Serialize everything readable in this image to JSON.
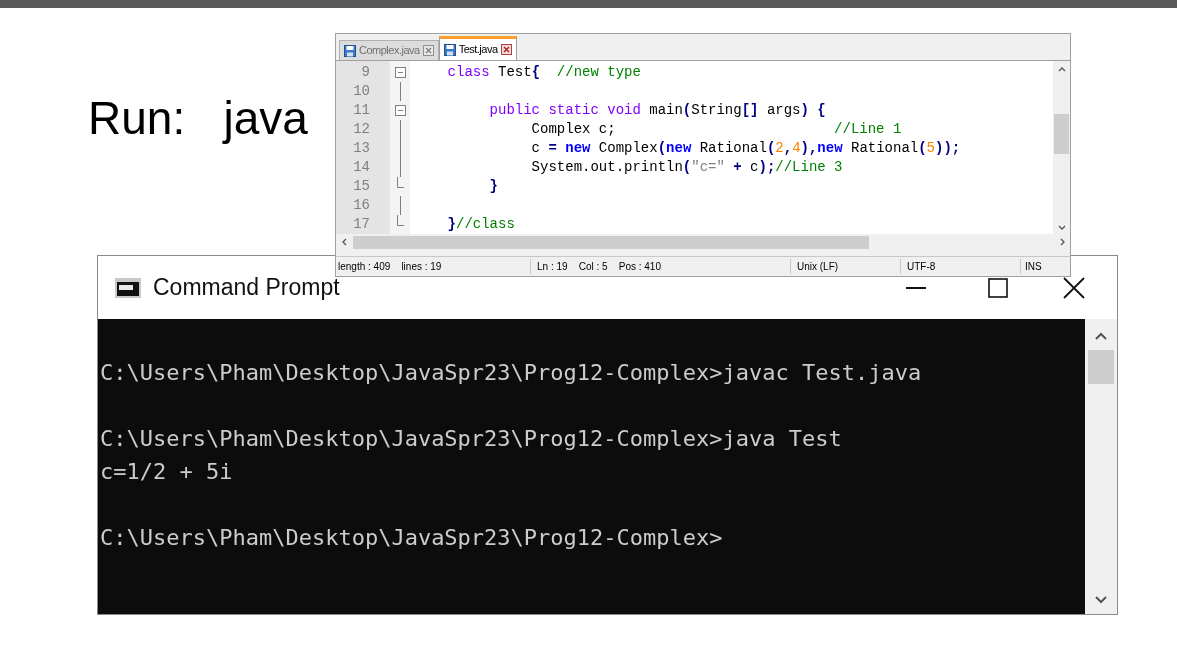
{
  "slide_text": "Run:   java",
  "editor": {
    "tabs": [
      {
        "label": "Complex.java",
        "selected": false
      },
      {
        "label": "Test.java",
        "selected": true
      }
    ],
    "lines": [
      {
        "number": "9",
        "kind": "fold-open",
        "tokens": [
          {
            "text": "    class",
            "kind": "keyword"
          },
          {
            "text": " Test",
            "kind": "plain"
          },
          {
            "text": "{",
            "kind": "operator"
          },
          {
            "text": "  //new type",
            "kind": "comment"
          }
        ]
      },
      {
        "number": "10",
        "kind": "fold-line"
      },
      {
        "number": "11",
        "kind": "fold-open",
        "tokens": [
          {
            "text": "         public static void",
            "kind": "keyword"
          },
          {
            "text": " main",
            "kind": "plain"
          },
          {
            "text": "(",
            "kind": "operator"
          },
          {
            "text": "String",
            "kind": "plain"
          },
          {
            "text": "[]",
            "kind": "operator"
          },
          {
            "text": " args",
            "kind": "plain"
          },
          {
            "text": ")",
            "kind": "operator"
          },
          {
            "text": " {",
            "kind": "operator"
          }
        ]
      },
      {
        "number": "12",
        "kind": "fold-line",
        "tokens": [
          {
            "text": "              Complex c;                          ",
            "kind": "plain"
          },
          {
            "text": "//Line 1",
            "kind": "comment"
          }
        ]
      },
      {
        "number": "13",
        "kind": "fold-line",
        "tokens": [
          {
            "text": "              c ",
            "kind": "plain"
          },
          {
            "text": "= ",
            "kind": "operator"
          },
          {
            "text": "new",
            "kind": "new"
          },
          {
            "text": " Complex",
            "kind": "plain"
          },
          {
            "text": "(",
            "kind": "operator"
          },
          {
            "text": "new",
            "kind": "new"
          },
          {
            "text": " Rational",
            "kind": "plain"
          },
          {
            "text": "(",
            "kind": "operator"
          },
          {
            "text": "2",
            "kind": "number"
          },
          {
            "text": ",",
            "kind": "operator"
          },
          {
            "text": "4",
            "kind": "number"
          },
          {
            "text": "),",
            "kind": "operator"
          },
          {
            "text": "new",
            "kind": "new"
          },
          {
            "text": " Rational",
            "kind": "plain"
          },
          {
            "text": "(",
            "kind": "operator"
          },
          {
            "text": "5",
            "kind": "number"
          },
          {
            "text": "));",
            "kind": "operator"
          }
        ]
      },
      {
        "number": "14",
        "kind": "fold-line",
        "tokens": [
          {
            "text": "              System.out.println",
            "kind": "plain"
          },
          {
            "text": "(",
            "kind": "operator"
          },
          {
            "text": "\"c=\"",
            "kind": "string"
          },
          {
            "text": " +",
            "kind": "operator"
          },
          {
            "text": " c",
            "kind": "plain"
          },
          {
            "text": ");",
            "kind": "operator"
          },
          {
            "text": "//Line 3",
            "kind": "comment"
          }
        ]
      },
      {
        "number": "15",
        "kind": "fold-end",
        "tokens": [
          {
            "text": "         }",
            "kind": "operator"
          }
        ]
      },
      {
        "number": "16",
        "kind": "fold-line"
      },
      {
        "number": "17",
        "kind": "fold-end",
        "tokens": [
          {
            "text": "    }",
            "kind": "operator"
          },
          {
            "text": "//class",
            "kind": "comment"
          }
        ]
      }
    ],
    "status_bar": [
      "length : 409    lines : 19",
      "Ln : 19    Col : 5    Pos : 410",
      "Unix (LF)",
      "UTF-8",
      "INS"
    ]
  },
  "console": {
    "title": "Command Prompt",
    "lines": [
      "C:\\Users\\Pham\\Desktop\\JavaSpr23\\Prog12-Complex>javac Test.java",
      "C:\\Users\\Pham\\Desktop\\JavaSpr23\\Prog12-Complex>java Test",
      "c=1/2 + 5i",
      "C:\\Users\\Pham\\Desktop\\JavaSpr23\\Prog12-Complex>"
    ]
  }
}
